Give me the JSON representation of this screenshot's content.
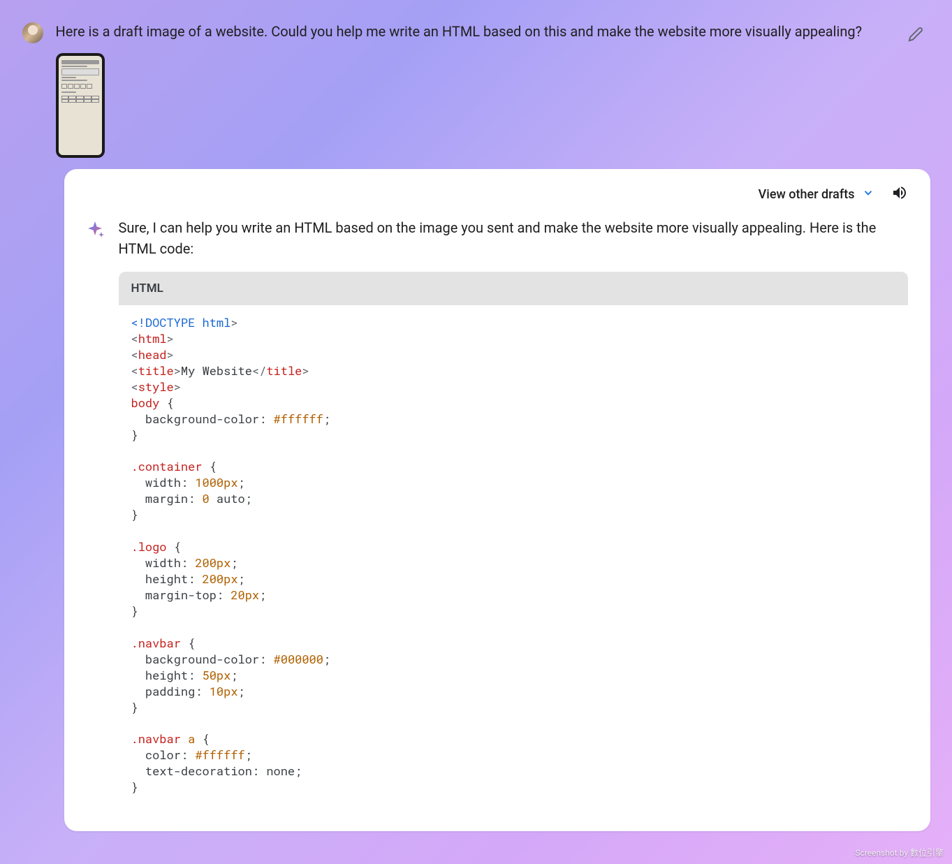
{
  "user_message": {
    "text": "Here is a draft image of a website. Could you help me write an HTML based on this and make the website more visually appealing?"
  },
  "response": {
    "view_drafts_label": "View other drafts",
    "intro_text": "Sure, I can help you write an HTML based on the image you sent and make the website more visually appealing. Here is the HTML code:",
    "code_language": "HTML",
    "code_tokens": [
      {
        "t": "<!DOCTYPE ",
        "c": "doctype"
      },
      {
        "t": "html",
        "c": "doctype-kw"
      },
      {
        "t": ">\n",
        "c": "punct"
      },
      {
        "t": "<",
        "c": "punct"
      },
      {
        "t": "html",
        "c": "tag"
      },
      {
        "t": ">\n",
        "c": "punct"
      },
      {
        "t": "<",
        "c": "punct"
      },
      {
        "t": "head",
        "c": "tag"
      },
      {
        "t": ">\n",
        "c": "punct"
      },
      {
        "t": "<",
        "c": "punct"
      },
      {
        "t": "title",
        "c": "tag"
      },
      {
        "t": ">",
        "c": "punct"
      },
      {
        "t": "My Website",
        "c": "text"
      },
      {
        "t": "</",
        "c": "punct"
      },
      {
        "t": "title",
        "c": "tag"
      },
      {
        "t": ">\n",
        "c": "punct"
      },
      {
        "t": "<",
        "c": "punct"
      },
      {
        "t": "style",
        "c": "tag"
      },
      {
        "t": ">\n",
        "c": "punct"
      },
      {
        "t": "body",
        "c": "selector"
      },
      {
        "t": " {\n",
        "c": "prop"
      },
      {
        "t": "  background-color: ",
        "c": "prop"
      },
      {
        "t": "#ffffff",
        "c": "value"
      },
      {
        "t": ";\n",
        "c": "prop"
      },
      {
        "t": "}\n\n",
        "c": "prop"
      },
      {
        "t": ".container",
        "c": "selector"
      },
      {
        "t": " {\n",
        "c": "prop"
      },
      {
        "t": "  width: ",
        "c": "prop"
      },
      {
        "t": "1000px",
        "c": "value"
      },
      {
        "t": ";\n",
        "c": "prop"
      },
      {
        "t": "  margin: ",
        "c": "prop"
      },
      {
        "t": "0",
        "c": "value"
      },
      {
        "t": " auto;\n",
        "c": "prop"
      },
      {
        "t": "}\n\n",
        "c": "prop"
      },
      {
        "t": ".logo",
        "c": "selector"
      },
      {
        "t": " {\n",
        "c": "prop"
      },
      {
        "t": "  width: ",
        "c": "prop"
      },
      {
        "t": "200px",
        "c": "value"
      },
      {
        "t": ";\n",
        "c": "prop"
      },
      {
        "t": "  height: ",
        "c": "prop"
      },
      {
        "t": "200px",
        "c": "value"
      },
      {
        "t": ";\n",
        "c": "prop"
      },
      {
        "t": "  margin-top: ",
        "c": "prop"
      },
      {
        "t": "20px",
        "c": "value"
      },
      {
        "t": ";\n",
        "c": "prop"
      },
      {
        "t": "}\n\n",
        "c": "prop"
      },
      {
        "t": ".navbar",
        "c": "selector"
      },
      {
        "t": " {\n",
        "c": "prop"
      },
      {
        "t": "  background-color: ",
        "c": "prop"
      },
      {
        "t": "#000000",
        "c": "value"
      },
      {
        "t": ";\n",
        "c": "prop"
      },
      {
        "t": "  height: ",
        "c": "prop"
      },
      {
        "t": "50px",
        "c": "value"
      },
      {
        "t": ";\n",
        "c": "prop"
      },
      {
        "t": "  padding: ",
        "c": "prop"
      },
      {
        "t": "10px",
        "c": "value"
      },
      {
        "t": ";\n",
        "c": "prop"
      },
      {
        "t": "}\n\n",
        "c": "prop"
      },
      {
        "t": ".navbar",
        "c": "selector"
      },
      {
        "t": " ",
        "c": "prop"
      },
      {
        "t": "a",
        "c": "selector2"
      },
      {
        "t": " {\n",
        "c": "prop"
      },
      {
        "t": "  color: ",
        "c": "prop"
      },
      {
        "t": "#ffffff",
        "c": "value"
      },
      {
        "t": ";\n",
        "c": "prop"
      },
      {
        "t": "  text-decoration: none;\n",
        "c": "prop"
      },
      {
        "t": "}\n\n",
        "c": "prop"
      }
    ]
  },
  "watermark": "Screenshot by 數位引擎"
}
